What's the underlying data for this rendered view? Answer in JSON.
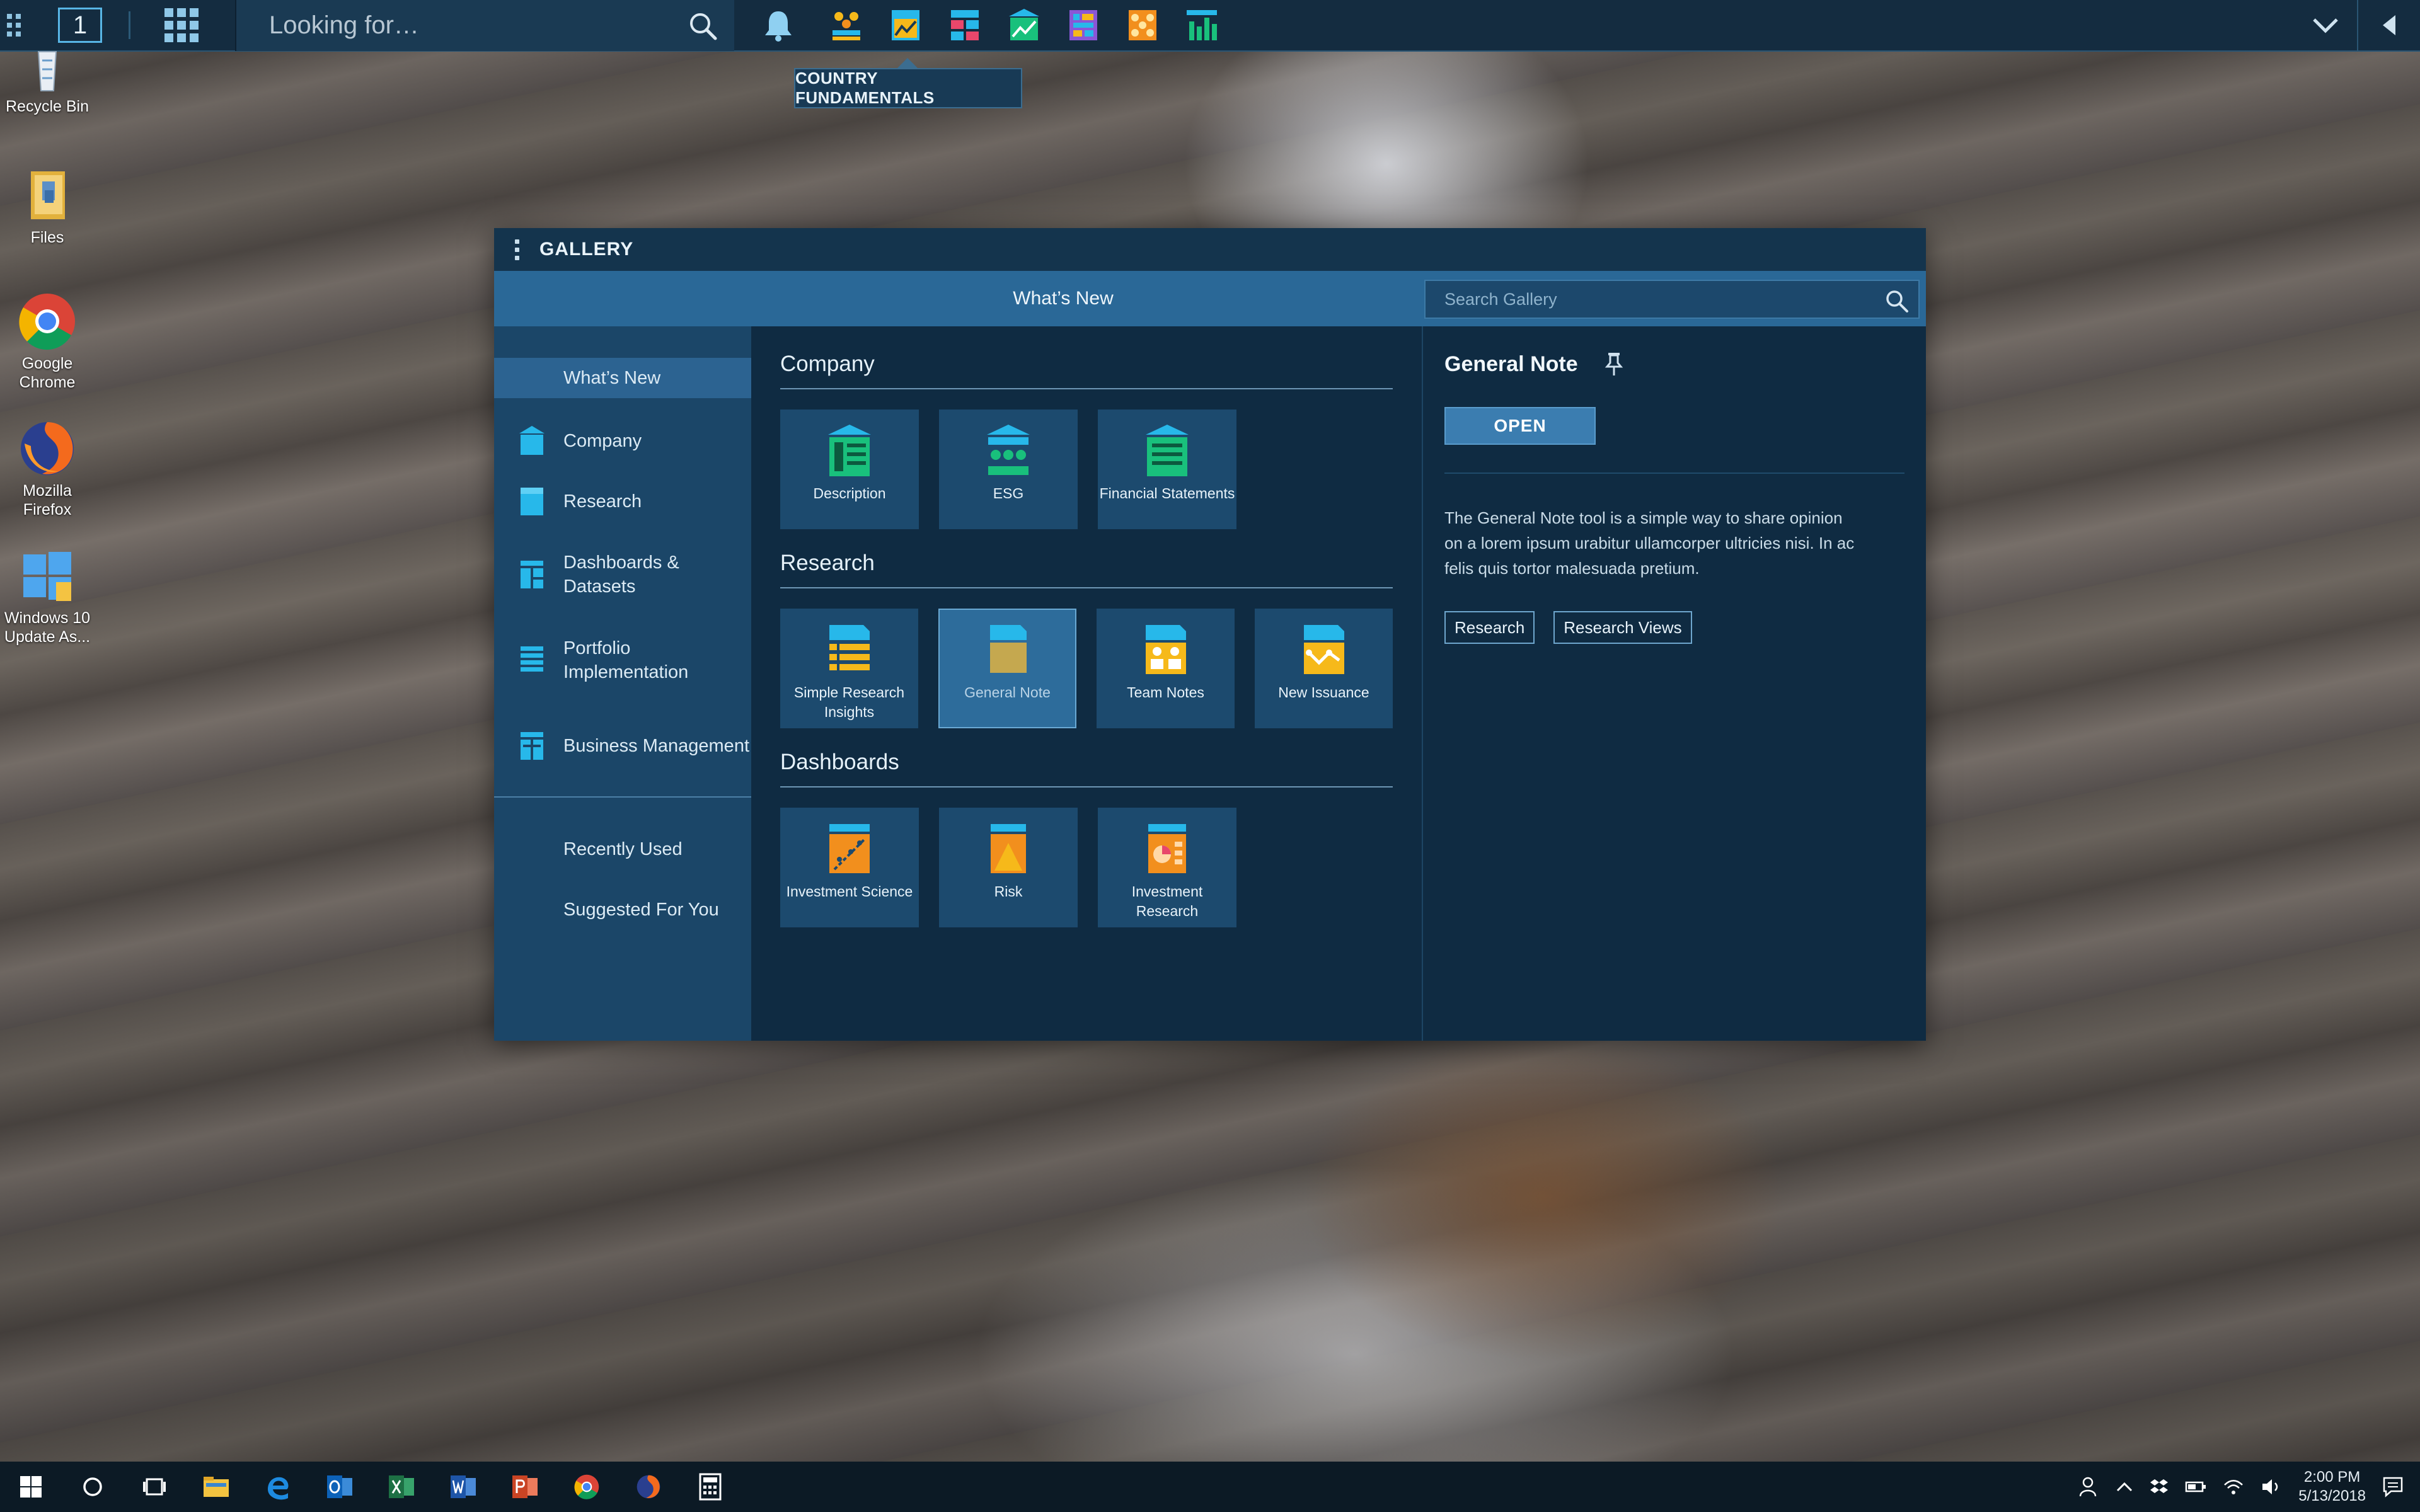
{
  "topbar": {
    "workspace_number": "1",
    "search_placeholder": "Looking for…",
    "tooltip": "COUNTRY FUNDAMENTALS"
  },
  "desktop": [
    {
      "label": "Recycle Bin"
    },
    {
      "label": "Files"
    },
    {
      "label": "Google Chrome"
    },
    {
      "label": "Mozilla Firefox"
    },
    {
      "label": "Windows 10 Update As..."
    }
  ],
  "gallery": {
    "title": "GALLERY",
    "banner_title": "What’s New",
    "search_placeholder": "Search Gallery",
    "sidebar": {
      "whats_new": "What’s New",
      "company": "Company",
      "research": "Research",
      "dashboards": "Dashboards & Datasets",
      "portfolio": "Portfolio Implementation",
      "business": "Business Management",
      "recently_used": "Recently Used",
      "suggested": "Suggested For You"
    },
    "sections": {
      "company": {
        "title": "Company",
        "tiles": [
          "Description",
          "ESG",
          "Financial Statements"
        ]
      },
      "research": {
        "title": "Research",
        "tiles": [
          "Simple Research Insights",
          "General Note",
          "Team Notes",
          "New Issuance"
        ]
      },
      "dashboards": {
        "title": "Dashboards",
        "tiles": [
          "Investment Science",
          "Risk",
          "Investment Research"
        ]
      }
    },
    "detail": {
      "title": "General Note",
      "open_label": "OPEN",
      "description": "The General Note tool is a simple way to share opinion on a lorem ipsum urabitur ullamcorper ultricies nisi. In ac felis quis tortor malesuada pretium.",
      "tags": [
        "Research",
        "Research Views"
      ]
    }
  },
  "taskbar": {
    "time": "2:00 PM",
    "date": "5/13/2018"
  },
  "colors": {
    "accent": "#2a6897",
    "panel": "#0f2b42",
    "sidebar": "#1b4668",
    "tile": "#1c4a6e",
    "icon_cyan": "#27b8ea",
    "icon_green": "#19c07c",
    "icon_yellow": "#f6b91a",
    "icon_orange": "#f28f1d"
  }
}
